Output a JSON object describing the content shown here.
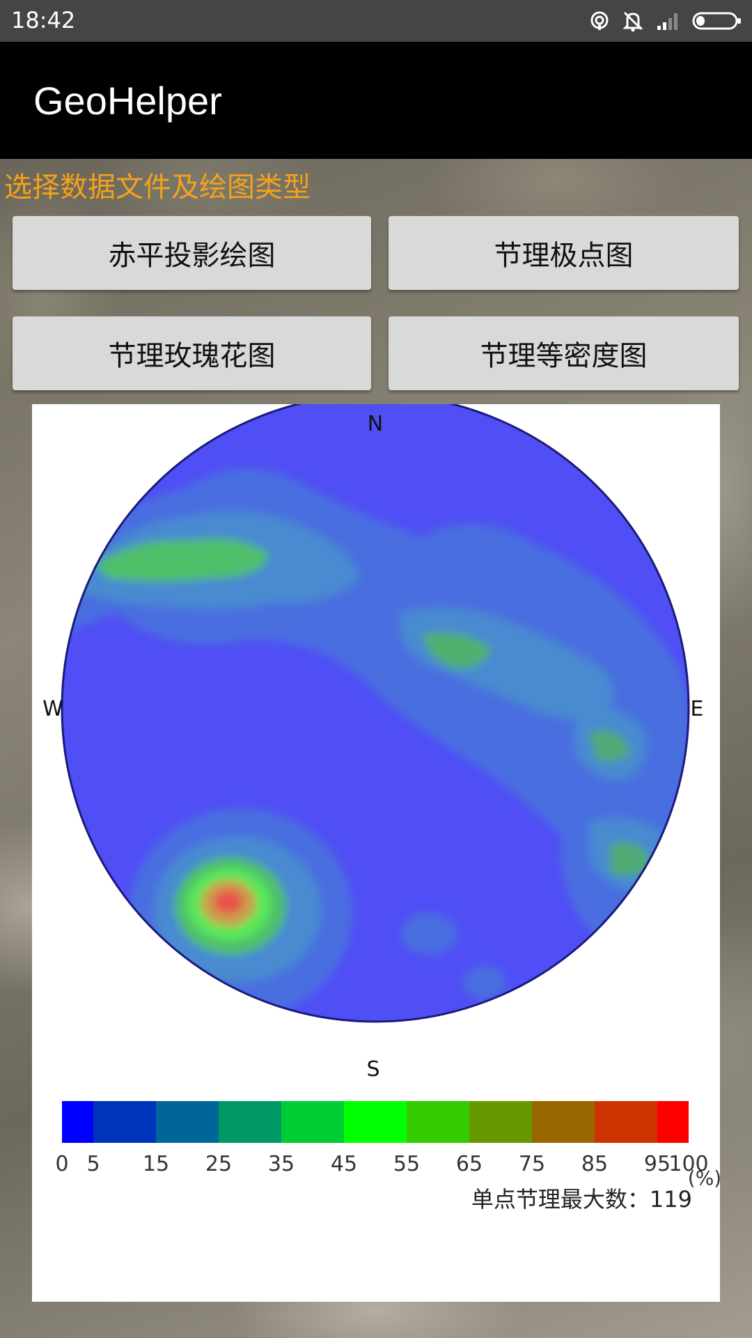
{
  "status_bar": {
    "time": "18:42",
    "icons": [
      "hotspot-icon",
      "alarm-off-icon",
      "signal-icon",
      "battery-icon"
    ]
  },
  "app_bar": {
    "title": "GeoHelper"
  },
  "prompt": {
    "text": "选择数据文件及绘图类型"
  },
  "buttons": {
    "stereographic": "赤平投影绘图",
    "joint_pole": "节理极点图",
    "joint_rose": "节理玫瑰花图",
    "joint_density": "节理等密度图"
  },
  "chart": {
    "directions": {
      "north": "N",
      "south": "S",
      "east": "E",
      "west": "W"
    },
    "max_count_label": "单点节理最大数：",
    "max_count_value": "119"
  },
  "chart_data": {
    "type": "heatmap",
    "title": "",
    "projection": "equal-area stereonet (pole density)",
    "directions": [
      "N",
      "E",
      "S",
      "W"
    ],
    "colorbar": {
      "unit": "(%)",
      "ticks": [
        "0",
        "5",
        "15",
        "25",
        "35",
        "45",
        "55",
        "65",
        "75",
        "85",
        "95",
        "100"
      ],
      "bins": [
        {
          "from": 0,
          "to": 5,
          "color": "#0000ff"
        },
        {
          "from": 5,
          "to": 15,
          "color": "#0033bb"
        },
        {
          "from": 15,
          "to": 25,
          "color": "#006699"
        },
        {
          "from": 25,
          "to": 35,
          "color": "#009966"
        },
        {
          "from": 35,
          "to": 45,
          "color": "#00cc33"
        },
        {
          "from": 45,
          "to": 55,
          "color": "#00ff00"
        },
        {
          "from": 55,
          "to": 65,
          "color": "#33cc00"
        },
        {
          "from": 65,
          "to": 75,
          "color": "#669900"
        },
        {
          "from": 75,
          "to": 85,
          "color": "#996600"
        },
        {
          "from": 85,
          "to": 95,
          "color": "#cc3300"
        },
        {
          "from": 95,
          "to": 100,
          "color": "#ff0000"
        }
      ]
    },
    "max_single_point_count": 119,
    "density_regions": [
      {
        "location": "NW band",
        "level_percent_range": [
          25,
          45
        ]
      },
      {
        "location": "NE-E band",
        "level_percent_range": [
          25,
          45
        ]
      },
      {
        "location": "SW maximum",
        "level_percent_range": [
          85,
          100
        ]
      }
    ]
  },
  "colors": {
    "accent_prompt": "#f5a21b",
    "app_bar": "#000000",
    "status_bar": "#454545",
    "button_bg": "#d8d9d8",
    "stereonet_background": "#4f4ff5"
  }
}
